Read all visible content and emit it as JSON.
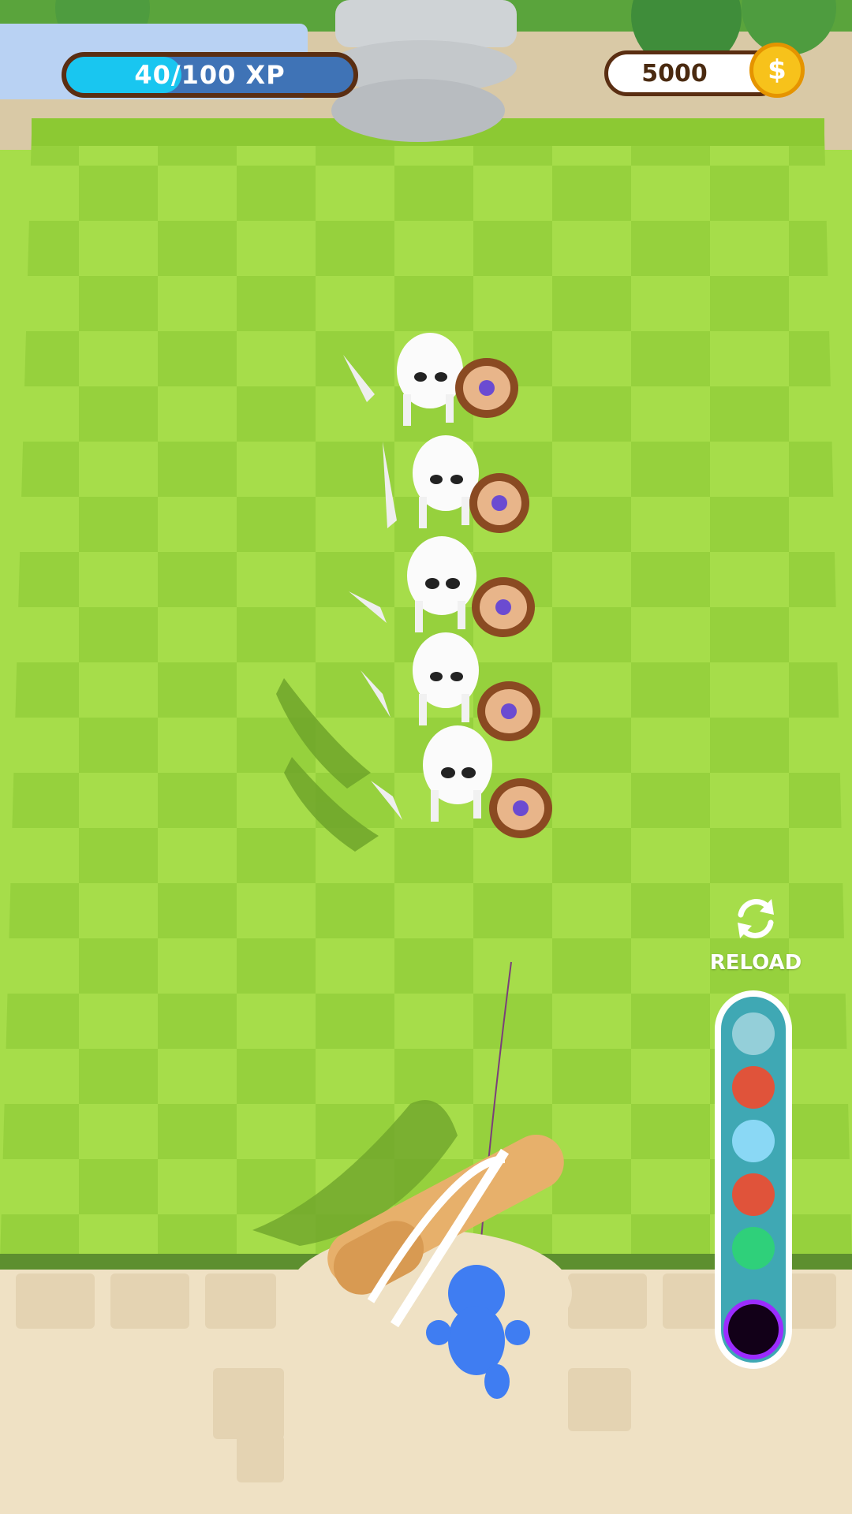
{
  "hud": {
    "xp_text": "40/100 XP",
    "xp_progress": 0.4,
    "coins": "5000",
    "coin_symbol": "$"
  },
  "reload": {
    "label": "RELOAD"
  },
  "ammo": [
    {
      "name": "ice-ball",
      "color": "#cde9f2"
    },
    {
      "name": "fire-ball",
      "color": "#e0533a"
    },
    {
      "name": "lightning-ball",
      "color": "#8ad8f5"
    },
    {
      "name": "fire-ball",
      "color": "#e0533a"
    },
    {
      "name": "poison-ball",
      "color": "#2fd07a"
    },
    {
      "name": "void-ball",
      "color": "#120018"
    }
  ],
  "enemies": {
    "type": "skeleton",
    "count": 5
  },
  "colors": {
    "grass_light": "#a6dd4a",
    "grass_dark": "#93cf3b",
    "wall": "#efe1c4",
    "player": "#3f7df2"
  }
}
